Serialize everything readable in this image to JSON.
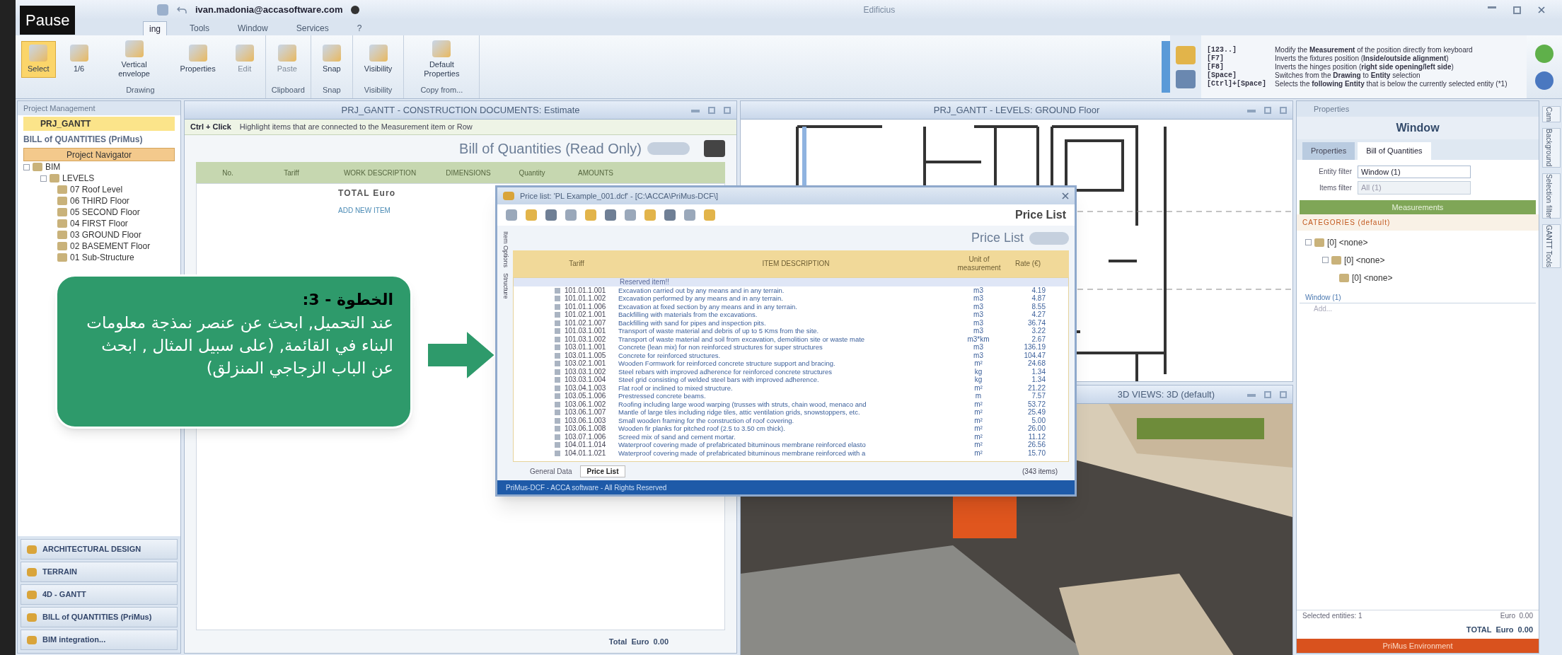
{
  "player": {
    "pause_tip": "Pause"
  },
  "title_bar": {
    "user": "ivan.madonia@accasoftware.com",
    "title": "Edificius"
  },
  "menu_tabs": [
    {
      "label": "ing",
      "selected": true
    },
    {
      "label": "Tools",
      "selected": false
    },
    {
      "label": "Window",
      "selected": false
    },
    {
      "label": "Services",
      "selected": false
    },
    {
      "label": "?",
      "selected": false
    }
  ],
  "ribbon": {
    "groups": [
      {
        "label": "Drawing",
        "buttons": [
          {
            "label": "Select",
            "disabled": false,
            "selected": true
          },
          {
            "label": "1/6",
            "disabled": false,
            "selected": false
          },
          {
            "label": "Vertical envelope",
            "disabled": false,
            "selected": false
          },
          {
            "label": "Properties",
            "disabled": false,
            "selected": false
          },
          {
            "label": "Edit",
            "disabled": true,
            "selected": false
          }
        ]
      },
      {
        "label": "Clipboard",
        "buttons": [
          {
            "label": "Paste",
            "disabled": true,
            "selected": false
          }
        ]
      },
      {
        "label": "Snap",
        "buttons": [
          {
            "label": "Snap",
            "disabled": false,
            "selected": false
          }
        ]
      },
      {
        "label": "Visibility",
        "buttons": [
          {
            "label": "Visibility",
            "disabled": false,
            "selected": false
          }
        ]
      },
      {
        "label": "Copy from...",
        "buttons": [
          {
            "label": "Default Properties",
            "disabled": false,
            "selected": false
          }
        ]
      }
    ],
    "shortcuts": [
      {
        "key": "[123..]",
        "text": "Modify the **Measurement** of the position directly from keyboard"
      },
      {
        "key": "[F7]",
        "text": "Inverts the fixtures position (**Inside/outside alignment**)"
      },
      {
        "key": "[F8]",
        "text": "Inverts the hinges position (**right side opening/left side**)"
      },
      {
        "key": "[Space]",
        "text": "Switches from the **Drawing** to **Entity** selection"
      },
      {
        "key": "[Ctrl]+[Space]",
        "text": "Selects the **following Entity** that is below the currently selected entity (*1)"
      }
    ]
  },
  "project_panel": {
    "title": "Project Management",
    "project": "PRJ_GANTT",
    "section": "BILL of QUANTITIES (PriMus)",
    "navigator": "Project Navigator",
    "tree": [
      {
        "label": "BIM",
        "expanded": true,
        "children": [
          {
            "label": "LEVELS",
            "expanded": true,
            "children": [
              {
                "label": "07 Roof Level"
              },
              {
                "label": "06 THIRD Floor"
              },
              {
                "label": "05 SECOND Floor"
              },
              {
                "label": "04 FIRST Floor"
              },
              {
                "label": "03 GROUND Floor"
              },
              {
                "label": "02 BASEMENT Floor"
              },
              {
                "label": "01 Sub-Structure"
              }
            ]
          }
        ]
      }
    ],
    "modules": [
      "ARCHITECTURAL DESIGN",
      "TERRAIN",
      "4D - GANTT",
      "BILL of QUANTITIES (PriMus)",
      "BIM integration..."
    ]
  },
  "boq_panel": {
    "title": "PRJ_GANTT - CONSTRUCTION DOCUMENTS: Estimate",
    "hint_key": "Ctrl + Click",
    "hint": "Highlight items that are connected to the Measurement item or Row",
    "heading": "Bill of Quantities (Read Only)",
    "columns": [
      "No.",
      "Tariff",
      "WORK DESCRIPTION",
      "DIMENSIONS",
      "Quantity",
      "AMOUNTS"
    ],
    "total_label": "TOTAL Euro",
    "add_item": "ADD NEW ITEM",
    "footer_total": "Total  Euro  0.00"
  },
  "plan_view": {
    "title": "PRJ_GANTT - LEVELS: GROUND Floor"
  },
  "view_3d": {
    "title": "3D VIEWS: 3D (default)"
  },
  "properties_panel": {
    "header": "Properties",
    "title": "Window",
    "tabs": [
      {
        "label": "Properties",
        "selected": false
      },
      {
        "label": "Bill of Quantities",
        "selected": true
      }
    ],
    "entity_filter_label": "Entity filter",
    "entity_filter": "Window (1)",
    "items_filter_label": "Items filter",
    "items_filter": "All (1)",
    "measurements": "Measurements",
    "categories": "CATEGORIES (default)",
    "category_tree": [
      {
        "label": "[0] <none>",
        "children": [
          {
            "label": "[0] <none>",
            "children": [
              {
                "label": "[0] <none>"
              }
            ]
          }
        ]
      }
    ],
    "entity": "Window (1)",
    "add": "Add...",
    "selected_entities": "Selected entities: 1",
    "euro": "Euro  0.00",
    "total": "TOTAL  Euro  0.00",
    "environment": "PriMus Environment"
  },
  "side_tabs": [
    "Cam",
    "Background",
    "Selection filter",
    "GANTT Tools"
  ],
  "price_list_dialog": {
    "title": "Price list: 'PL Example_001.dcf' - [C:\\ACCA\\PriMus-DCF\\]",
    "brand": "Price List",
    "heading": "Price List",
    "side_tabs": [
      "Item Options",
      "Structure"
    ],
    "columns": [
      "Tariff",
      "ITEM DESCRIPTION",
      "Unit of measurement",
      "Rate (€)"
    ],
    "reserved": "Reserved item!!",
    "rows": [
      [
        "101.01.1.001",
        "Excavation carried out by any means and in any terrain.",
        "m3",
        "4.19"
      ],
      [
        "101.01.1.002",
        "Excavation performed by any means and in any terrain.",
        "m3",
        "4.87"
      ],
      [
        "101.01.1.006",
        "Excavation at fixed section by any means and in any terrain.",
        "m3",
        "8.55"
      ],
      [
        "101.02.1.001",
        "Backfilling with materials from the excavations.",
        "m3",
        "4.27"
      ],
      [
        "101.02.1.007",
        "Backfilling with sand for pipes and inspection pits.",
        "m3",
        "36.74"
      ],
      [
        "101.03.1.001",
        "Transport of waste material and debris of up to 5 Kms from the site.",
        "m3",
        "3.22"
      ],
      [
        "101.03.1.002",
        "Transport of waste material and soil from excavation, demolition site or waste mate",
        "m3*km",
        "2.67"
      ],
      [
        "103.01.1.001",
        "Concrete (lean mix) for non reinforced structures for super structures",
        "m3",
        "136.19"
      ],
      [
        "103.01.1.005",
        "Concrete for reinforced structures.",
        "m3",
        "104.47"
      ],
      [
        "103.02.1.001",
        "Wooden Formwork for reinforced concrete structure support and bracing.",
        "m²",
        "24.68"
      ],
      [
        "103.03.1.002",
        "Steel rebars with improved adherence for reinforced concrete structures",
        "kg",
        "1.34"
      ],
      [
        "103.03.1.004",
        "Steel grid consisting of welded steel bars with improved adherence.",
        "kg",
        "1.34"
      ],
      [
        "103.04.1.003",
        "Flat roof or inclined to mixed structure.",
        "m²",
        "21.22"
      ],
      [
        "103.05.1.006",
        "Prestressed concrete beams.",
        "m",
        "7.57"
      ],
      [
        "103.06.1.002",
        "Roofing including large wood warping (trusses with struts, chain wood, menaco and",
        "m²",
        "53.72"
      ],
      [
        "103.06.1.007",
        "Mantle of large tiles including ridge tiles, attic ventilation grids, snowstoppers, etc.",
        "m²",
        "25.49"
      ],
      [
        "103.06.1.003",
        "Small wooden framing for the construction of roof covering.",
        "m²",
        "5.00"
      ],
      [
        "103.06.1.008",
        "Wooden fir planks for pitched roof (2.5 to 3.50 cm thick).",
        "m²",
        "26.00"
      ],
      [
        "103.07.1.006",
        "Screed mix of sand and cement mortar.",
        "m²",
        "11.12"
      ],
      [
        "104.01.1.014",
        "Waterproof covering made of prefabricated bituminous membrane reinforced elasto",
        "m²",
        "26.56"
      ],
      [
        "104.01.1.021",
        "Waterproof covering made of prefabricated bituminous membrane reinforced with a",
        "m²",
        "15.70"
      ]
    ],
    "bottom_tabs": [
      {
        "label": "General Data",
        "selected": false
      },
      {
        "label": "Price List",
        "selected": true
      }
    ],
    "count": "(343 items)",
    "footer": "PriMus-DCF - ACCA software - All Rights Reserved"
  },
  "callout": {
    "title": "الخطوة - 3:",
    "body": "عند التحميل, ابحث عن عنصر نمذجة معلومات البناء في القائمة, (على سبيل المثال , ابحث عن الباب الزجاجي المنزلق)"
  }
}
